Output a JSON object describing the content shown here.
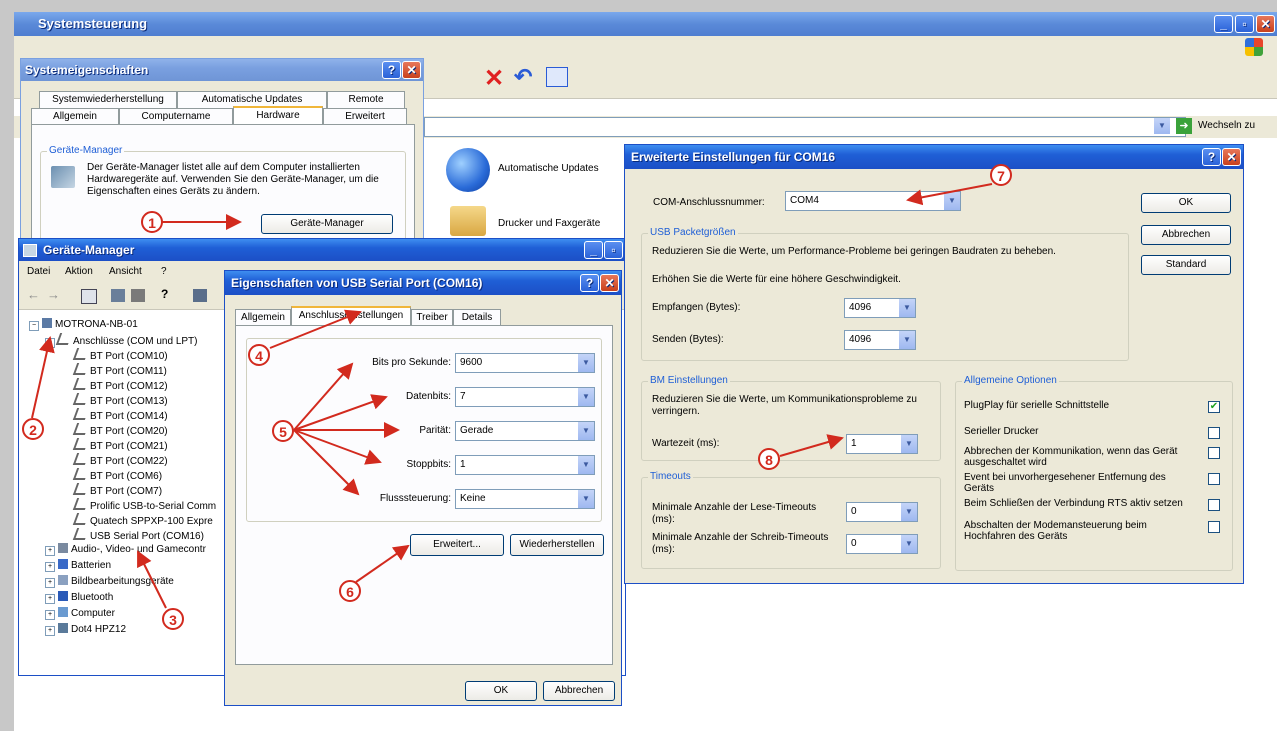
{
  "systemsteuerung": {
    "title": "Systemsteuerung",
    "address_go_label": "Wechseln zu",
    "items": [
      {
        "label": "Automatische Updates"
      },
      {
        "label": "Drucker und Faxgeräte"
      }
    ]
  },
  "systemeigenschaften": {
    "title": "Systemeigenschaften",
    "tabs_row1": [
      "Systemwiederherstellung",
      "Automatische Updates",
      "Remote"
    ],
    "tabs_row2": [
      "Allgemein",
      "Computername",
      "Hardware",
      "Erweitert"
    ],
    "group_label": "Geräte-Manager",
    "description": "Der Geräte-Manager listet alle auf dem Computer installierten Hardwaregeräte auf. Verwenden Sie den Geräte-Manager, um die Eigenschaften eines Geräts zu ändern.",
    "button_label": "Geräte-Manager"
  },
  "geraete_manager": {
    "title": "Geräte-Manager",
    "menu": [
      "Datei",
      "Aktion",
      "Ansicht",
      "?"
    ],
    "root": "MOTRONA-NB-01",
    "ports_group": "Anschlüsse (COM und LPT)",
    "ports": [
      "BT Port (COM10)",
      "BT Port (COM11)",
      "BT Port (COM12)",
      "BT Port (COM13)",
      "BT Port (COM14)",
      "BT Port (COM20)",
      "BT Port (COM21)",
      "BT Port (COM22)",
      "BT Port (COM6)",
      "BT Port (COM7)",
      "Prolific USB-to-Serial Comm",
      "Quatech SPPXP-100 Expre",
      "USB Serial Port (COM16)"
    ],
    "categories": [
      "Audio-, Video- und Gamecontr",
      "Batterien",
      "Bildbearbeitungsgeräte",
      "Bluetooth",
      "Computer",
      "Dot4 HPZ12"
    ]
  },
  "eigenschaften": {
    "title": "Eigenschaften von USB Serial Port (COM16)",
    "tabs": [
      "Allgemein",
      "Anschlusseinstellungen",
      "Treiber",
      "Details"
    ],
    "fields": [
      {
        "label": "Bits pro Sekunde:",
        "value": "9600"
      },
      {
        "label": "Datenbits:",
        "value": "7"
      },
      {
        "label": "Parität:",
        "value": "Gerade"
      },
      {
        "label": "Stoppbits:",
        "value": "1"
      },
      {
        "label": "Flusssteuerung:",
        "value": "Keine"
      }
    ],
    "btn_erweitert": "Erweitert...",
    "btn_wiederherstellen": "Wiederherstellen",
    "btn_ok": "OK",
    "btn_abbrechen": "Abbrechen"
  },
  "erweitert": {
    "title": "Erweiterte Einstellungen für COM16",
    "com_label": "COM-Anschlussnummer:",
    "com_value": "COM4",
    "usb_group": "USB Packetgrößen",
    "usb_text1": "Reduzieren Sie die Werte, um Performance-Probleme bei geringen Baudraten zu beheben.",
    "usb_text2": "Erhöhen Sie die Werte für eine höhere Geschwindigkeit.",
    "empfangen_label": "Empfangen (Bytes):",
    "empfangen_value": "4096",
    "senden_label": "Senden (Bytes):",
    "senden_value": "4096",
    "bm_group": "BM Einstellungen",
    "bm_text": "Reduzieren Sie die Werte, um Kommunikationsprobleme zu verringern.",
    "wartezeit_label": "Wartezeit (ms):",
    "wartezeit_value": "1",
    "timeouts_group": "Timeouts",
    "lese_label": "Minimale Anzahle der Lese-Timeouts (ms):",
    "lese_value": "0",
    "schreib_label": "Minimale Anzahle der Schreib-Timeouts (ms):",
    "schreib_value": "0",
    "options_group": "Allgemeine Optionen",
    "options": [
      {
        "label": "PlugPlay für serielle Schnittstelle",
        "checked": true
      },
      {
        "label": "Serieller Drucker",
        "checked": false
      },
      {
        "label": "Abbrechen der Kommunikation, wenn das Gerät ausgeschaltet wird",
        "checked": false
      },
      {
        "label": "Event bei unvorhergesehener Entfernung des Geräts",
        "checked": false
      },
      {
        "label": "Beim Schließen der Verbindung RTS aktiv setzen",
        "checked": false
      },
      {
        "label": "Abschalten der Modemansteuerung beim Hochfahren des Geräts",
        "checked": false
      }
    ],
    "btn_ok": "OK",
    "btn_abbrechen": "Abbrechen",
    "btn_standard": "Standard"
  },
  "markers": [
    "1",
    "2",
    "3",
    "4",
    "5",
    "6",
    "7",
    "8"
  ],
  "colors": {
    "marker": "#d22a1e",
    "xp_blue": "#1f5fd6",
    "dialog_bg": "#ece9d8"
  }
}
